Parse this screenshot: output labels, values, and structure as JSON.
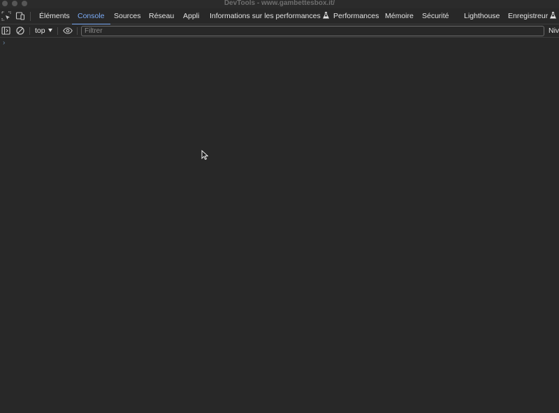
{
  "window": {
    "title": "DevTools - www.gambettesbox.it/"
  },
  "tabs": [
    {
      "label": "Éléments",
      "active": false
    },
    {
      "label": "Console",
      "active": true
    },
    {
      "label": "Sources",
      "active": false
    },
    {
      "label": "Réseau",
      "active": false
    },
    {
      "label": "Appli",
      "active": false
    },
    {
      "label": "Informations sur les performances",
      "active": false,
      "icon": "flask-icon"
    },
    {
      "label": "Performances",
      "active": false
    },
    {
      "label": "Mémoire",
      "active": false
    },
    {
      "label": "Sécurité",
      "active": false
    },
    {
      "label": "Lighthouse",
      "active": false
    },
    {
      "label": "Enregistreur",
      "active": false,
      "icon": "flask-icon"
    }
  ],
  "toolbar": {
    "context": "top",
    "filter_placeholder": "Filtrer",
    "filter_value": "",
    "levels_label": "Nive"
  },
  "console": {
    "prompt_symbol": "›"
  },
  "colors": {
    "background": "#282828",
    "accent": "#7cacf8",
    "text": "#e3e3e3"
  }
}
